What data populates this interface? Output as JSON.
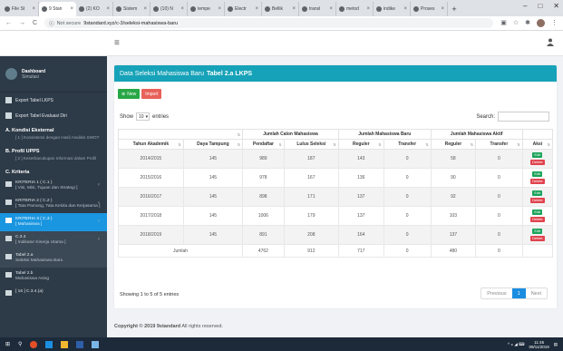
{
  "browser": {
    "tabs": [
      {
        "label": "File St",
        "active": false
      },
      {
        "label": "9 Stan",
        "active": true
      },
      {
        "label": "(2) KO",
        "active": false
      },
      {
        "label": "Sistem",
        "active": false
      },
      {
        "label": "(10) N",
        "active": false
      },
      {
        "label": "tempe",
        "active": false
      },
      {
        "label": "Electr",
        "active": false
      },
      {
        "label": "Bellik",
        "active": false
      },
      {
        "label": "transl",
        "active": false
      },
      {
        "label": "metod",
        "active": false
      },
      {
        "label": "indike",
        "active": false
      },
      {
        "label": "Proses",
        "active": false
      }
    ],
    "new_tab": "+",
    "window_controls": [
      "–",
      "□",
      "✕"
    ],
    "security": "Not secure",
    "url": "9standard.xyz/c-3/seleksi-mahasiswa-baru"
  },
  "apptop": {
    "menu_icon": "≡",
    "user_icon": "👤"
  },
  "sidebar": {
    "user": {
      "name": "Dashboard",
      "sub": "Simulasi"
    },
    "items": [
      {
        "label": "Export Tabel LKPS"
      },
      {
        "label": "Export Tabel Evaluasi Diri"
      }
    ],
    "kondisi": {
      "heading": "A. Kondisi Eksternal",
      "sub": "[ 1 ] Konsistensi dengan Hasil Analisis SWOT"
    },
    "profil": {
      "heading": "B. Profil UPPS",
      "sub": "[ 2 ] Keserbacukupan Informasi dalam Profil"
    },
    "kriteria_heading": "C. Kriteria",
    "kriteria": [
      {
        "title": "KRITERIA 1 ( C.1 )",
        "sub": "[ Visi, Misi, Tujuan dan Strategi ]",
        "active": false,
        "dark": false
      },
      {
        "title": "KRITERIA 2 ( C.2 )",
        "sub": "[ Tata Pamong, Tata Kelola dan Kerjasama ]",
        "active": false,
        "dark": false
      },
      {
        "title": "KRITERIA 3 ( C.3 )",
        "sub": "[ Mahasiswa ]",
        "active": true,
        "dark": false
      },
      {
        "title": "C.3.4",
        "sub": "[ Indikator Kinerja Utama ]",
        "active": false,
        "dark": true
      },
      {
        "title": "Tabel 2.a",
        "sub": "Seleksi Mahasiswa Baru",
        "active": false,
        "dark": true
      },
      {
        "title": "Tabel 2.b",
        "sub": "Mahasiswa Asing",
        "active": false,
        "dark": false
      },
      {
        "title": "[ 16 ] C.3.4.(a)",
        "sub": "",
        "active": false,
        "dark": false
      }
    ]
  },
  "panel": {
    "title_prefix": "Data Seleksi Mahasiswa Baru",
    "title_bold": "Tabel 2.a LKPS",
    "btn_new": "New",
    "btn_import": "Import",
    "show": "Show",
    "show_value": "10",
    "entries": "entries",
    "search_label": "Search:"
  },
  "table": {
    "group_headers": [
      "Jumlah Calon Mahasiswa",
      "Jumlah Mahasiswa Baru",
      "Jumlah Mahasiswa Aktif"
    ],
    "headers": [
      "Tahun Akademik",
      "Daya Tampung",
      "Pendaftar",
      "Lulus Seleksi",
      "Reguler",
      "Transfer",
      "Reguler",
      "Transfer",
      "Aksi"
    ],
    "rows": [
      [
        "2014/2015",
        "145",
        "989",
        "187",
        "143",
        "0",
        "58",
        "0"
      ],
      [
        "2015/2016",
        "145",
        "978",
        "167",
        "136",
        "0",
        "90",
        "0"
      ],
      [
        "2016/2017",
        "145",
        "898",
        "171",
        "137",
        "0",
        "92",
        "0"
      ],
      [
        "2017/2018",
        "145",
        "1006",
        "179",
        "137",
        "0",
        "103",
        "0"
      ],
      [
        "2018/2019",
        "145",
        "891",
        "208",
        "164",
        "0",
        "137",
        "0"
      ]
    ],
    "edit_label": "Edit",
    "delete_label": "Delete",
    "footer": {
      "label": "Jumlah",
      "values": [
        "4762",
        "912",
        "717",
        "0",
        "480",
        "0"
      ]
    }
  },
  "info": "Showing 1 to 5 of 5 entries",
  "pager": {
    "prev": "Previous",
    "current": "1",
    "next": "Next"
  },
  "copyright": {
    "bold": "Copyright © 2019 9standard",
    "rest": "All rights reserved."
  },
  "taskbar": {
    "time": "11:45",
    "date": "09/11/2019"
  }
}
